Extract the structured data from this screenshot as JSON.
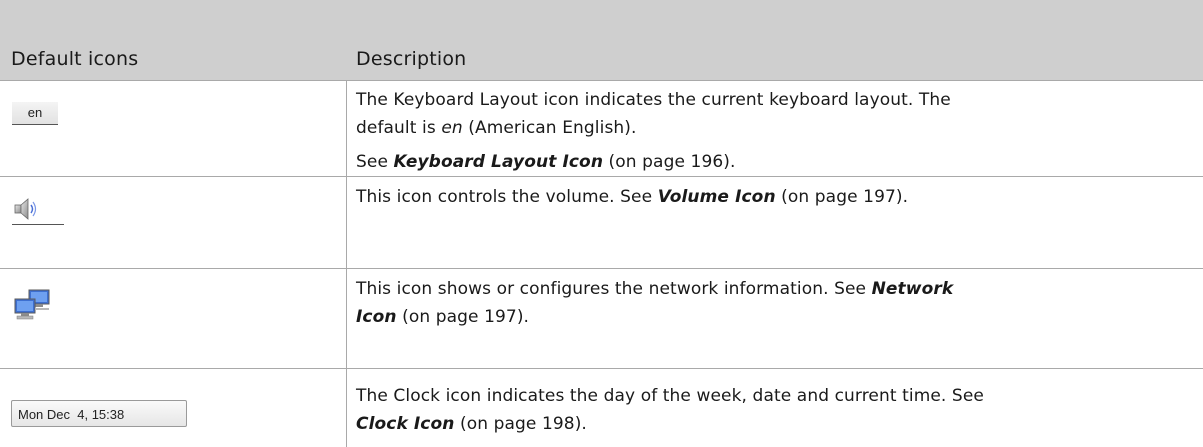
{
  "header": {
    "col1": "Default icons",
    "col2": "Description"
  },
  "rows": [
    {
      "icon": "en",
      "icon_name": "keyboard-layout-icon",
      "line1": "The Keyboard Layout icon indicates the current keyboard layout. The",
      "line2a": "default is ",
      "line2b": "en",
      "line2c": " (American English).",
      "see_prefix": "See ",
      "link": "Keyboard Layout Icon",
      "page": " (on page 196)."
    },
    {
      "icon_name": "volume-icon",
      "text": "This icon controls the volume. See ",
      "link": "Volume Icon",
      "page": " (on page 197)."
    },
    {
      "icon_name": "network-icon",
      "line1": "This icon shows or configures the network information. See ",
      "link1": "Network",
      "link2": "Icon",
      "page": " (on page 197)."
    },
    {
      "icon": "Mon Dec  4, 15:38",
      "icon_name": "clock-icon",
      "line1": "The Clock icon indicates the day of the week, date and current time. See",
      "link": "Clock Icon",
      "page": " (on page 198)."
    }
  ]
}
